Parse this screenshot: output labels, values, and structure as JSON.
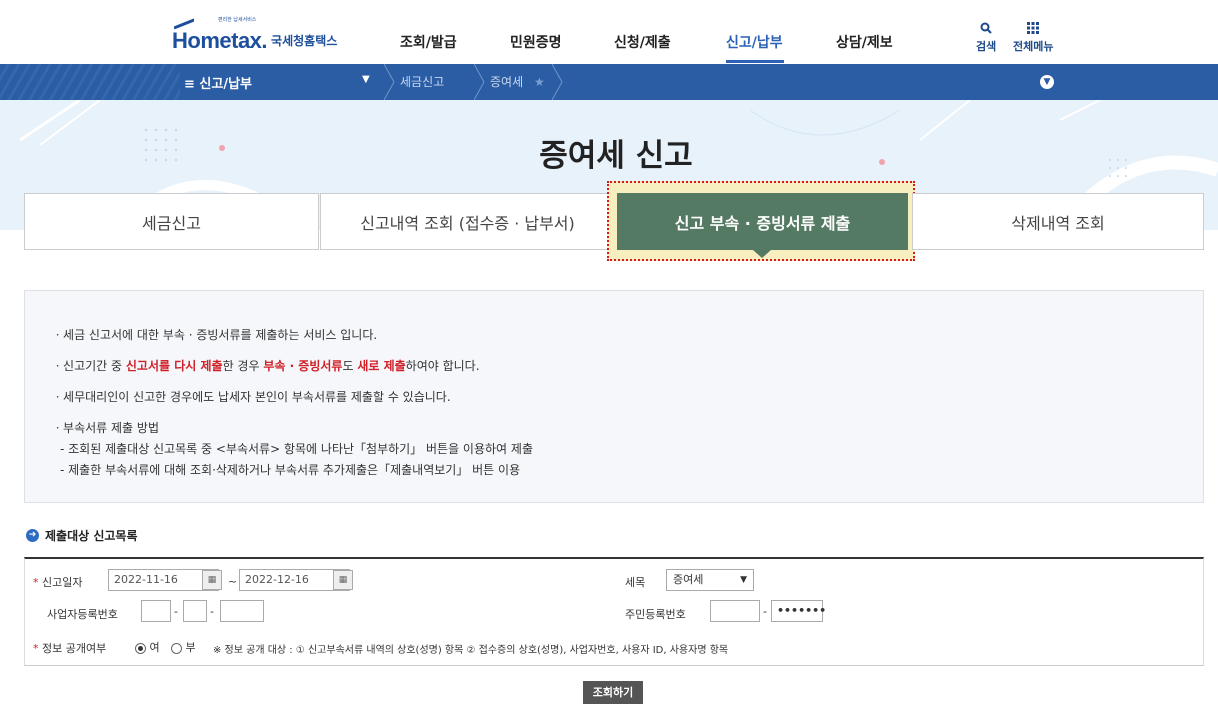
{
  "header": {
    "logo_tiny": "편리한 납세서비스",
    "logo_text": "Hometax.",
    "logo_sub": "국세청홈택스",
    "menu": [
      "조회/발급",
      "민원증명",
      "신청/제출",
      "신고/납부",
      "상담/제보"
    ],
    "search_label": "검색",
    "allmenu_label": "전체메뉴"
  },
  "navbar": {
    "menu_label": "≡ 신고/납부",
    "crumbs": [
      "세금신고",
      "증여세"
    ]
  },
  "banner": {
    "title": "증여세 신고"
  },
  "tabs": [
    "세금신고",
    "신고내역 조회 (접수증 · 납부서)",
    "신고 부속 · 증빙서류 제출",
    "삭제내역 조회"
  ],
  "info": {
    "line1": "ㆍ세금 신고서에 대한 부속 · 증빙서류를 제출하는 서비스 입니다.",
    "line2_a": "ㆍ신고기간 중 ",
    "line2_b": "신고서를 다시 제출",
    "line2_c": "한 경우 ",
    "line2_d": "부속 · 증빙서류",
    "line2_e": "도 ",
    "line2_f": "새로 제출",
    "line2_g": "하여야 합니다.",
    "line3": "ㆍ세무대리인이 신고한 경우에도 납세자 본인이 부속서류를 제출할 수 있습니다.",
    "line4": "ㆍ부속서류 제출 방법",
    "line5": "- 조회된 제출대상 신고목록 중 <부속서류> 항목에 나타난「첨부하기」 버튼을 이용하여 제출",
    "line6": "- 제출한 부속서류에 대해 조회·삭제하거나 부속서류 추가제출은「제출내역보기」 버튼 이용"
  },
  "section": {
    "title": "제출대상 신고목록"
  },
  "form": {
    "date_label": "신고일자",
    "date_from": "2022-11-16",
    "date_tilde": "~",
    "date_to": "2022-12-16",
    "tax_label": "세목",
    "tax_value": "증여세",
    "bizno_label": "사업자등록번호",
    "rrn_label": "주민등록번호",
    "rrn_masked": "•••••••",
    "dash": "-",
    "public_label": "정보 공개여부",
    "opt_yes": "여",
    "opt_no": "부",
    "note": "※ 정보 공개 대상 : ① 신고부속서류 내역의 상호(성명) 항목 ② 접수증의 상호(성명), 사업자번호, 사용자 ID, 사용자명 항목"
  },
  "button": {
    "search": "조회하기"
  }
}
